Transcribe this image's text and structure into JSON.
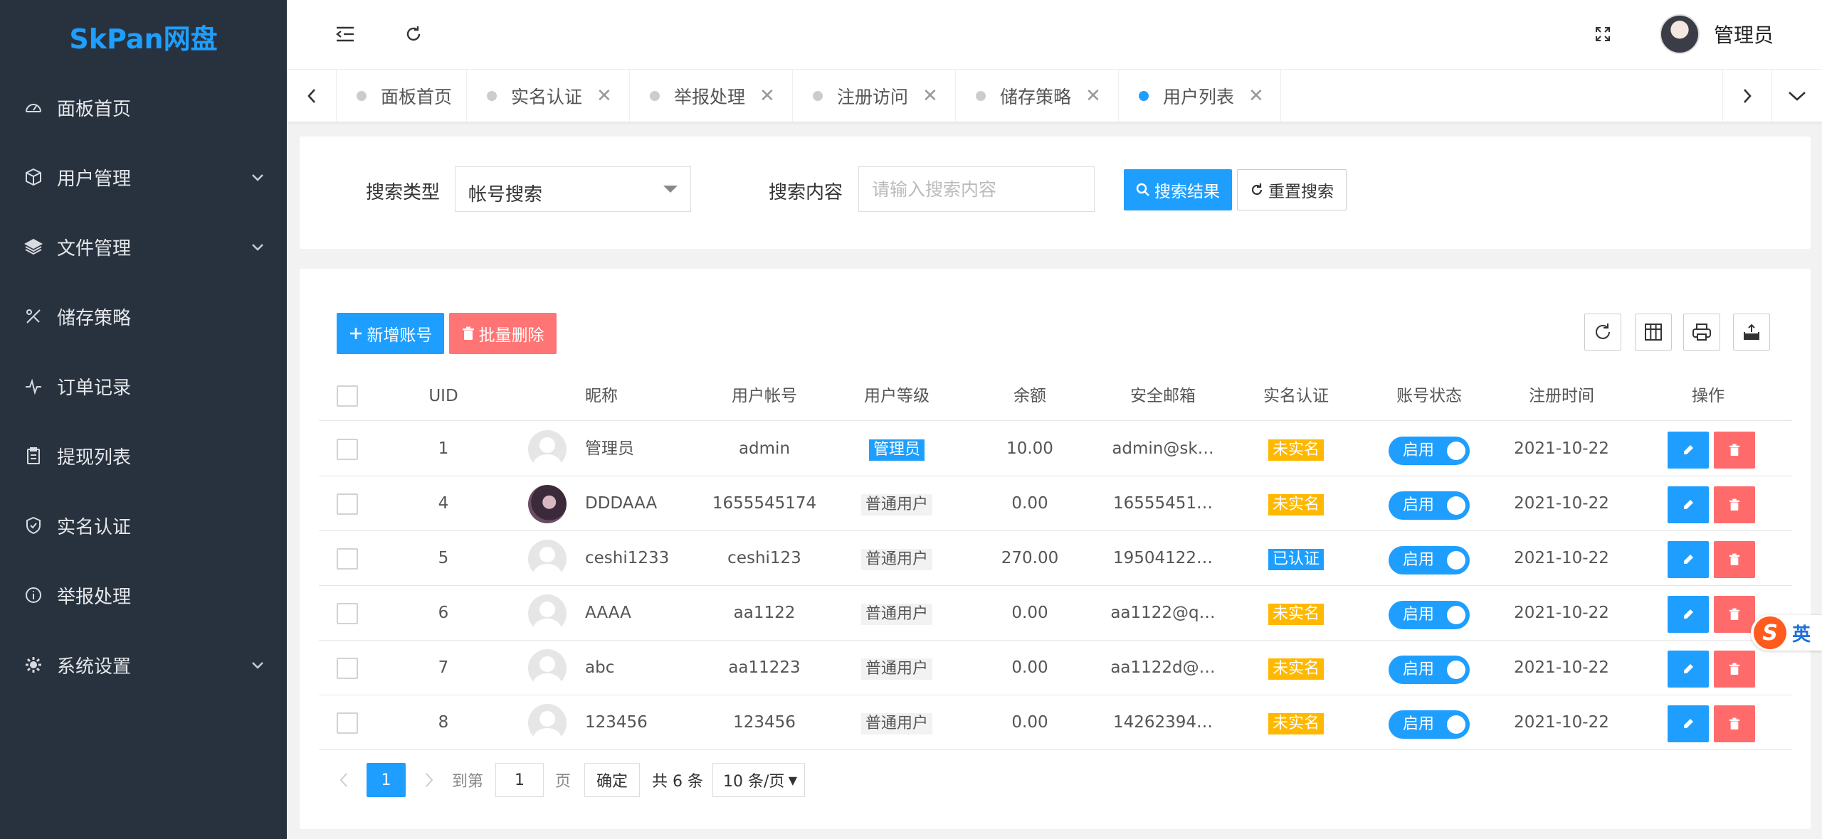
{
  "sidebar": {
    "logo": "SkPan网盘",
    "items": [
      {
        "label": "面板首页",
        "icon": "dashboard-icon",
        "has_children": false
      },
      {
        "label": "用户管理",
        "icon": "cube-icon",
        "has_children": true
      },
      {
        "label": "文件管理",
        "icon": "layers-icon",
        "has_children": true
      },
      {
        "label": "储存策略",
        "icon": "tools-icon",
        "has_children": false
      },
      {
        "label": "订单记录",
        "icon": "pulse-icon",
        "has_children": false
      },
      {
        "label": "提现列表",
        "icon": "clipboard-icon",
        "has_children": false
      },
      {
        "label": "实名认证",
        "icon": "shield-icon",
        "has_children": false
      },
      {
        "label": "举报处理",
        "icon": "info-icon",
        "has_children": false
      },
      {
        "label": "系统设置",
        "icon": "gear-icon",
        "has_children": true
      }
    ]
  },
  "header": {
    "user_name": "管理员"
  },
  "tabs": [
    {
      "label": "面板首页",
      "closable": false,
      "active": false
    },
    {
      "label": "实名认证",
      "closable": true,
      "active": false
    },
    {
      "label": "举报处理",
      "closable": true,
      "active": false
    },
    {
      "label": "注册访问",
      "closable": true,
      "active": false
    },
    {
      "label": "储存策略",
      "closable": true,
      "active": false
    },
    {
      "label": "用户列表",
      "closable": true,
      "active": true
    }
  ],
  "search": {
    "type_label": "搜索类型",
    "type_value": "帐号搜索",
    "content_label": "搜索内容",
    "content_placeholder": "请输入搜索内容",
    "content_value": "",
    "submit_label": "搜索结果",
    "reset_label": "重置搜索"
  },
  "toolbar": {
    "add_label": "新增账号",
    "batch_delete_label": "批量删除"
  },
  "table": {
    "columns": [
      "UID",
      "昵称",
      "用户帐号",
      "用户等级",
      "余额",
      "安全邮箱",
      "实名认证",
      "账号状态",
      "注册时间",
      "操作"
    ],
    "rows": [
      {
        "uid": "1",
        "nickname": "管理员",
        "account": "admin",
        "level": "管理员",
        "level_type": "admin",
        "balance": "10.00",
        "email": "admin@sk…",
        "verify": "未实名",
        "status": "启用",
        "reg_time": "2021-10-22",
        "avatar": "default"
      },
      {
        "uid": "4",
        "nickname": "DDDAAA",
        "account": "1655545174",
        "level": "普通用户",
        "level_type": "normal",
        "balance": "0.00",
        "email": "16555451…",
        "verify": "未实名",
        "status": "启用",
        "reg_time": "2021-10-22",
        "avatar": "photo"
      },
      {
        "uid": "5",
        "nickname": "ceshi1233",
        "account": "ceshi123",
        "level": "普通用户",
        "level_type": "normal",
        "balance": "270.00",
        "email": "19504122…",
        "verify": "已认证",
        "status": "启用",
        "reg_time": "2021-10-22",
        "avatar": "default"
      },
      {
        "uid": "6",
        "nickname": "AAAA",
        "account": "aa1122",
        "level": "普通用户",
        "level_type": "normal",
        "balance": "0.00",
        "email": "aa1122@q…",
        "verify": "未实名",
        "status": "启用",
        "reg_time": "2021-10-22",
        "avatar": "default"
      },
      {
        "uid": "7",
        "nickname": "abc",
        "account": "aa11223",
        "level": "普通用户",
        "level_type": "normal",
        "balance": "0.00",
        "email": "aa1122d@…",
        "verify": "未实名",
        "status": "启用",
        "reg_time": "2021-10-22",
        "avatar": "default"
      },
      {
        "uid": "8",
        "nickname": "123456",
        "account": "123456",
        "level": "普通用户",
        "level_type": "normal",
        "balance": "0.00",
        "email": "14262394…",
        "verify": "未实名",
        "status": "启用",
        "reg_time": "2021-10-22",
        "avatar": "default"
      }
    ]
  },
  "pagination": {
    "current_page": "1",
    "goto_label": "到第",
    "goto_value": "1",
    "page_label": "页",
    "confirm_label": "确定",
    "total_label": "共 6 条",
    "page_size": "10 条/页"
  },
  "ime": {
    "logo": "S",
    "mode": "英"
  },
  "colors": {
    "primary": "#1e9fff",
    "sidebar_bg": "#28323f",
    "danger": "#ff5c5c",
    "warning": "#ffb800"
  }
}
